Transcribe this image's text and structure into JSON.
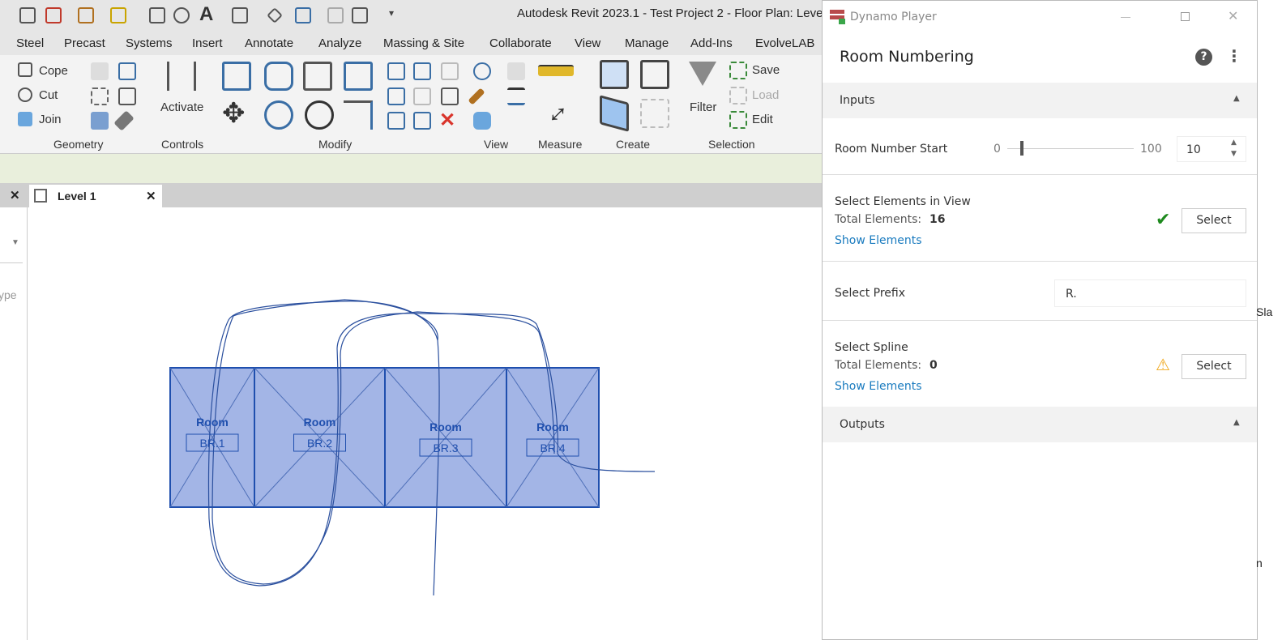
{
  "app": {
    "title": "Autodesk Revit 2023.1 - Test Project 2 - Floor Plan: Leve"
  },
  "quick_access_icons": [
    "print-icon",
    "pdf-icon",
    "measure-icon",
    "align-icon",
    "dimension-icon",
    "tag-icon",
    "text-icon",
    "3d-view-icon",
    "section-icon",
    "thin-lines-icon",
    "switch-windows-icon",
    "dropdown-icon"
  ],
  "ribbon_tabs": [
    "Steel",
    "Precast",
    "Systems",
    "Insert",
    "Annotate",
    "Analyze",
    "Massing & Site",
    "Collaborate",
    "View",
    "Manage",
    "Add-Ins",
    "EvolveLAB"
  ],
  "ribbon": {
    "geometry": {
      "cope": "Cope",
      "cut": "Cut",
      "join": "Join",
      "label": "Geometry"
    },
    "controls": {
      "activate": "Activate",
      "label": "Controls"
    },
    "modify": {
      "label": "Modify"
    },
    "view": {
      "label": "View"
    },
    "measure": {
      "label": "Measure"
    },
    "create": {
      "label": "Create"
    },
    "selection": {
      "filter": "Filter",
      "save": "Save",
      "load": "Load",
      "edit": "Edit",
      "label": "Selection"
    }
  },
  "view_tab": {
    "label": "Level 1",
    "close": "✕",
    "left_close": "✕"
  },
  "left_pane": {
    "partial_text": "ype"
  },
  "right_strip": {
    "partial_text": "Sla",
    "partial_text2": "n"
  },
  "plan": {
    "rooms": [
      {
        "name": "Room",
        "number": "BR.1"
      },
      {
        "name": "Room",
        "number": "BR.2"
      },
      {
        "name": "Room",
        "number": "BR.3"
      },
      {
        "name": "Room",
        "number": "BR.4"
      }
    ],
    "room_fill": "#a3b5e6",
    "line_color": "#1f4fae"
  },
  "dynamo": {
    "window_title": "Dynamo Player",
    "graph_title": "Room Numbering",
    "inputs_label": "Inputs",
    "outputs_label": "Outputs",
    "room_number_start": {
      "label": "Room Number Start",
      "min": "0",
      "max": "100",
      "value": "10",
      "slider_fraction": 0.1
    },
    "select_elements": {
      "label": "Select Elements in View",
      "total_label": "Total Elements:",
      "total": "16",
      "link": "Show Elements",
      "button": "Select",
      "status": "check-icon",
      "status_color": "#1e8a1e"
    },
    "select_prefix": {
      "label": "Select Prefix",
      "value": "R."
    },
    "select_spline": {
      "label": "Select Spline",
      "total_label": "Total Elements:",
      "total": "0",
      "link": "Show Elements",
      "button": "Select",
      "status": "warning-icon",
      "status_color": "#f0a81c"
    }
  }
}
